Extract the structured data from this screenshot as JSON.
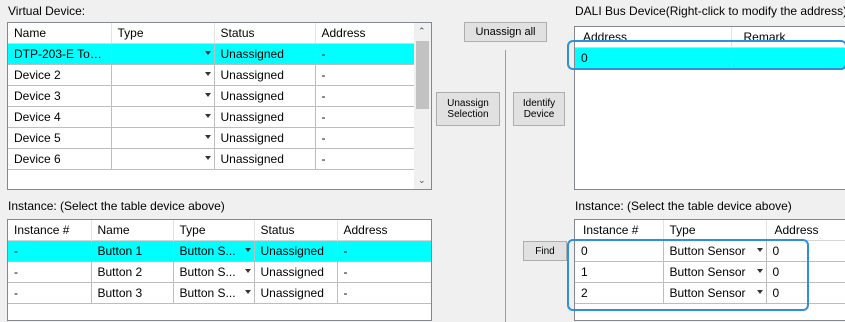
{
  "virtual_device": {
    "title": "Virtual Device:",
    "columns": [
      "Name",
      "Type",
      "Status",
      "Address"
    ],
    "rows": [
      {
        "name": "DTP-203-E Tou...",
        "type": "",
        "status": "Unassigned",
        "address": "-"
      },
      {
        "name": "Device 2",
        "type": "",
        "status": "Unassigned",
        "address": "-"
      },
      {
        "name": "Device 3",
        "type": "",
        "status": "Unassigned",
        "address": "-"
      },
      {
        "name": "Device 4",
        "type": "",
        "status": "Unassigned",
        "address": "-"
      },
      {
        "name": "Device 5",
        "type": "",
        "status": "Unassigned",
        "address": "-"
      },
      {
        "name": "Device 6",
        "type": "",
        "status": "Unassigned",
        "address": "-"
      }
    ]
  },
  "instance_left": {
    "title": "Instance:   (Select the table device above)",
    "columns": [
      "Instance #",
      "Name",
      "Type",
      "Status",
      "Address"
    ],
    "rows": [
      {
        "instance": "-",
        "name": "Button 1",
        "type": "Button S...",
        "status": "Unassigned",
        "address": "-"
      },
      {
        "instance": "-",
        "name": "Button 2",
        "type": "Button S...",
        "status": "Unassigned",
        "address": "-"
      },
      {
        "instance": "-",
        "name": "Button 3",
        "type": "Button S...",
        "status": "Unassigned",
        "address": "-"
      }
    ]
  },
  "buttons": {
    "unassign_all": "Unassign all",
    "unassign_selection": "Unassign Selection",
    "identify_device": "Identify Device",
    "find": "Find"
  },
  "dali_bus": {
    "title": "DALI Bus Device(Right-click to modify the address)",
    "columns": [
      "Address",
      "Remark"
    ],
    "rows": [
      {
        "address": "0",
        "remark": ""
      }
    ]
  },
  "instance_right": {
    "title": "Instance:   (Select the table device above)",
    "columns": [
      "Instance #",
      "Type",
      "Address"
    ],
    "rows": [
      {
        "instance": "0",
        "type": "Button Sensor",
        "address": "0"
      },
      {
        "instance": "1",
        "type": "Button Sensor",
        "address": "0"
      },
      {
        "instance": "2",
        "type": "Button Sensor",
        "address": "0"
      }
    ]
  },
  "colors": {
    "selection": "#00ffff",
    "highlight_border": "#2f8fd8"
  }
}
